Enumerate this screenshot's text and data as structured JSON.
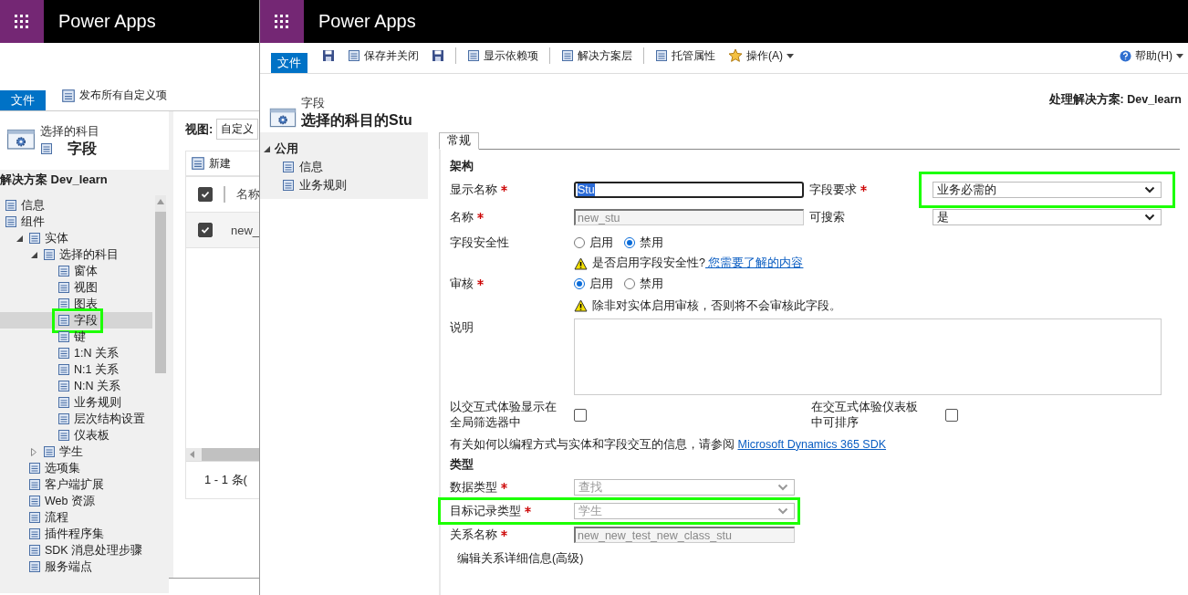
{
  "back_window": {
    "app_title": "Power Apps",
    "file_tab": "文件",
    "publish_button": "发布所有自定义项",
    "header": {
      "subtitle": "选择的科目",
      "title": "字段"
    },
    "solution_label": "解决方案 Dev_learn",
    "tree": [
      {
        "label": "信息"
      },
      {
        "label": "组件",
        "children": [
          {
            "label": "实体",
            "expanded": true,
            "children": [
              {
                "label": "选择的科目",
                "expanded": true,
                "children": [
                  {
                    "label": "窗体",
                    "selected": false
                  },
                  {
                    "label": "视图",
                    "selected": false
                  },
                  {
                    "label": "图表",
                    "selected": false
                  },
                  {
                    "label": "字段",
                    "selected": true,
                    "highlighted": true
                  },
                  {
                    "label": "键",
                    "selected": false
                  },
                  {
                    "label": "1:N 关系",
                    "selected": false
                  },
                  {
                    "label": "N:1 关系",
                    "selected": false
                  },
                  {
                    "label": "N:N 关系",
                    "selected": false
                  },
                  {
                    "label": "业务规则",
                    "selected": false
                  },
                  {
                    "label": "层次结构设置",
                    "selected": false
                  },
                  {
                    "label": "仪表板",
                    "selected": false
                  }
                ]
              },
              {
                "label": "学生",
                "expanded": false
              }
            ]
          },
          {
            "label": "选项集"
          },
          {
            "label": "客户端扩展"
          },
          {
            "label": "Web 资源"
          },
          {
            "label": "流程"
          },
          {
            "label": "插件程序集"
          },
          {
            "label": "SDK 消息处理步骤"
          },
          {
            "label": "服务端点"
          }
        ]
      }
    ],
    "view_label": "视图:",
    "view_select": "自定义",
    "grid": {
      "new_button": "新建",
      "header_checked": true,
      "columns": [
        "名称"
      ],
      "rows": [
        {
          "checked": true,
          "cells": [
            "new_"
          ]
        }
      ],
      "footer": "1 - 1 条("
    }
  },
  "front_window": {
    "app_title": "Power Apps",
    "file_tab": "文件",
    "toolbar": [
      {
        "kind": "icon"
      },
      {
        "kind": "button",
        "label": "保存并关闭"
      },
      {
        "kind": "icon"
      },
      {
        "kind": "separator"
      },
      {
        "kind": "button",
        "label": "显示依赖项"
      },
      {
        "kind": "separator"
      },
      {
        "kind": "button",
        "label": "解决方案层"
      },
      {
        "kind": "separator"
      },
      {
        "kind": "button",
        "label": "托管属性"
      },
      {
        "kind": "menu",
        "label": "操作(A)"
      }
    ],
    "help": "帮助(H)",
    "header": {
      "subtitle": "字段",
      "title": "选择的科目的Stu"
    },
    "solution": "处理解决方案: Dev_learn",
    "nav": {
      "group": "公用",
      "expanded": true,
      "items": [
        "信息",
        "业务规则"
      ]
    },
    "tabs": [
      {
        "label": "常规",
        "selected": true
      }
    ],
    "form": {
      "schema_heading": "架构",
      "display_name": {
        "label": "显示名称",
        "required": true,
        "value": "Stu"
      },
      "field_requirement": {
        "label": "字段要求",
        "required": true,
        "value": "业务必需的",
        "highlighted": true
      },
      "name": {
        "label": "名称",
        "required": true,
        "value": "new_stu",
        "disabled": true
      },
      "searchable": {
        "label": "可搜索",
        "required": false,
        "value": "是"
      },
      "field_security": {
        "label": "字段安全性",
        "options": [
          {
            "label": "启用",
            "selected": false
          },
          {
            "label": "禁用",
            "selected": true
          }
        ]
      },
      "security_note": {
        "text": "是否启用字段安全性?",
        "link": "您需要了解的内容"
      },
      "auditing": {
        "label": "审核",
        "required": true,
        "options": [
          {
            "label": "启用",
            "selected": true
          },
          {
            "label": "禁用",
            "selected": false
          }
        ]
      },
      "audit_note": {
        "text": "除非对实体启用审核，否则将不会审核此字段。"
      },
      "description": {
        "label": "说明"
      },
      "global_filter": {
        "label": "以交互式体验显示在全局筛选器中",
        "checked": false
      },
      "sortable": {
        "label": "在交互式体验仪表板中可排序",
        "checked": false
      },
      "sdk_note": {
        "text": "有关如何以编程方式与实体和字段交互的信息，请参阅",
        "link": "Microsoft Dynamics 365 SDK"
      },
      "type_heading": "类型",
      "data_type": {
        "label": "数据类型",
        "required": true,
        "value": "查找",
        "disabled": true,
        "highlighted": false
      },
      "target_type": {
        "label": "目标记录类型",
        "required": true,
        "value": "学生",
        "disabled": true,
        "highlighted": true
      },
      "relationship_name": {
        "label": "关系名称",
        "required": true,
        "value": "new_new_test_new_class_stu",
        "disabled": true
      },
      "edit_relationship": "编辑关系详细信息(高级)"
    }
  }
}
